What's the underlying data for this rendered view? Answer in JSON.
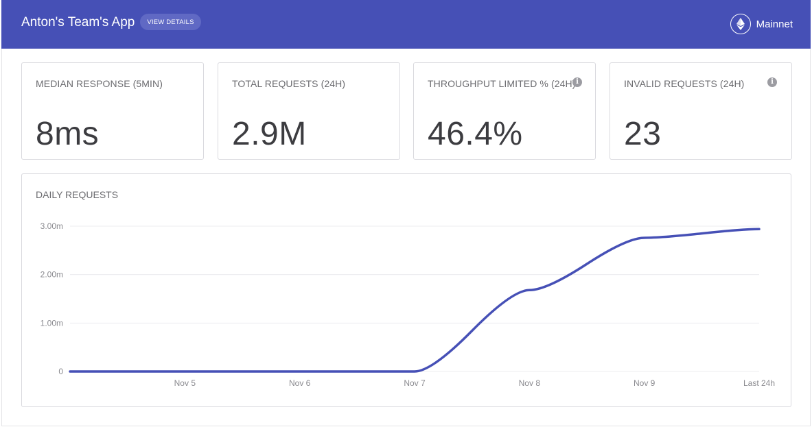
{
  "header": {
    "app_title": "Anton's Team's App",
    "view_details_label": "VIEW DETAILS",
    "network_label": "Mainnet",
    "network_icon": "ethereum-icon",
    "background_color": "#4650b6"
  },
  "stats": [
    {
      "label": "MEDIAN RESPONSE (5MIN)",
      "value": "8ms",
      "info": false
    },
    {
      "label": "TOTAL REQUESTS (24H)",
      "value": "2.9M",
      "info": false
    },
    {
      "label": "THROUGHPUT LIMITED % (24H)",
      "value": "46.4%",
      "info": true
    },
    {
      "label": "INVALID REQUESTS (24H)",
      "value": "23",
      "info": true
    }
  ],
  "chart_title": "DAILY REQUESTS",
  "chart_data": {
    "type": "line",
    "title": "DAILY REQUESTS",
    "xlabel": "",
    "ylabel": "",
    "categories": [
      "",
      "Nov 5",
      "Nov 6",
      "Nov 7",
      "Nov 8",
      "Nov 9",
      "Last 24h"
    ],
    "series": [
      {
        "values": [
          0,
          0,
          0,
          0,
          1.68,
          2.76,
          2.94
        ]
      }
    ],
    "y_ticks": [
      0,
      1,
      2,
      3
    ],
    "y_tick_labels": [
      "0",
      "1.00m",
      "2.00m",
      "3.00m"
    ],
    "ylim": [
      0,
      3
    ],
    "line_color": "#4650b6",
    "grid": true
  }
}
